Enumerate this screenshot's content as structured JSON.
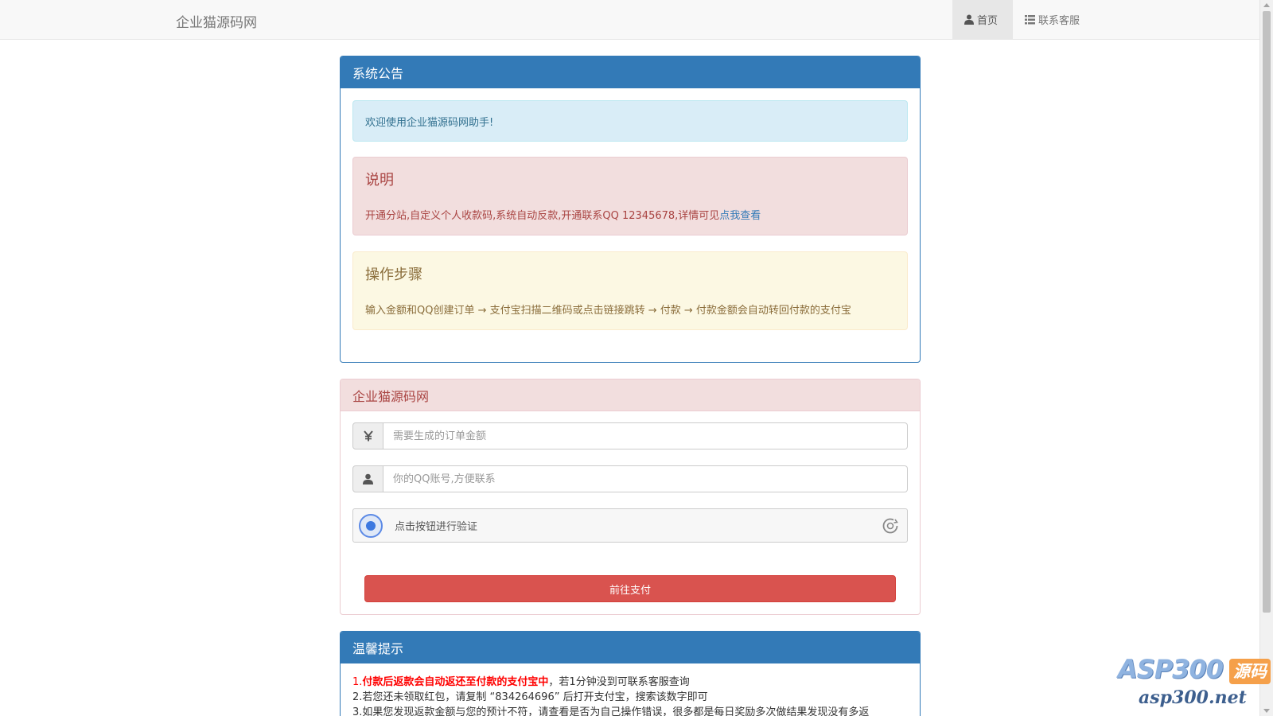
{
  "navbar": {
    "brand": "企业猫源码网",
    "items": [
      {
        "label": "首页",
        "icon": "user-icon",
        "active": true
      },
      {
        "label": "联系客服",
        "icon": "list-icon",
        "active": false
      }
    ]
  },
  "notice_panel": {
    "title": "系统公告",
    "welcome": "欢迎使用企业猫源码网助手!",
    "explain": {
      "heading": "说明",
      "text": "开通分站,自定义个人收款码,系统自动反款,开通联系QQ 12345678,详情可见",
      "link": "点我查看"
    },
    "steps": {
      "heading": "操作步骤",
      "text": "输入金额和QQ创建订单 → 支付宝扫描二维码或点击链接跳转 → 付款 → 付款金额会自动转回付款的支付宝"
    }
  },
  "form_panel": {
    "title": "企业猫源码网",
    "amount": {
      "placeholder": "需要生成的订单金额",
      "value": "",
      "icon": "yen-icon"
    },
    "qq": {
      "placeholder": "你的QQ账号,方便联系",
      "value": "",
      "icon": "user-icon"
    },
    "captcha_label": "点击按钮进行验证",
    "pay_button": "前往支付"
  },
  "tips_panel": {
    "title": "温馨提示",
    "line1_prefix": "1.",
    "line1_bold": "付款后返款会自动返还至付款的支付宝中",
    "line1_rest": "，若1分钟没到可联系客服查询",
    "line2": "2.若您还未领取红包，请复制 “834264696” 后打开支付宝，搜索该数字即可",
    "line3": "3.如果您发现返款金额与您的预计不符，请查看是否为自己操作错误，很多都是每日奖励多次做结果发现没有多返"
  },
  "watermark": {
    "logo": "ASP300",
    "badge": "源码",
    "url": "asp300.net"
  },
  "colors": {
    "primary": "#337ab7",
    "danger_button": "#d9534f",
    "info_bg": "#d9edf7",
    "danger_bg": "#f2dede",
    "warning_bg": "#fcf8e3"
  }
}
